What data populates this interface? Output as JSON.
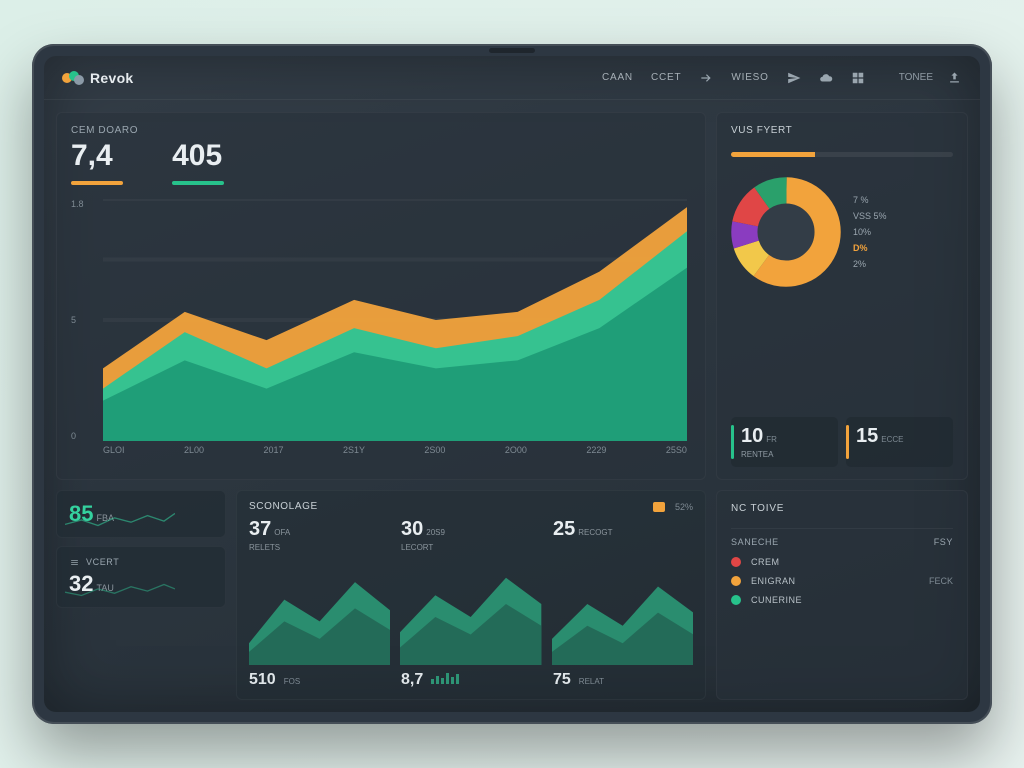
{
  "brand": "Revok",
  "nav": {
    "n0": "CAAN",
    "n1": "CCET",
    "n2": "WIESO"
  },
  "top_right": {
    "chip": "TONEE"
  },
  "main": {
    "metric1_label": "Cem Doaro",
    "metric1_value": "7,4",
    "metric2_value": "405",
    "y": {
      "t0": "1.8",
      "t1": "5",
      "t2": "0"
    },
    "x": {
      "c0": "GLOI",
      "c1": "2L00",
      "c2": "2017",
      "c3": "2S1Y",
      "c4": "2S00",
      "c5": "2O00",
      "c6": "2229",
      "c7": "25S0"
    }
  },
  "right": {
    "title": "Vus Fyert",
    "pie": {
      "l0": "7 %",
      "l1": "VSS 5%",
      "l2": "10%",
      "l3": "D%",
      "l4": "2%"
    },
    "m1_v": "10",
    "m1_s": "FR",
    "m1_cap": "Rentea",
    "m2_v": "15",
    "m2_s": "ECCE",
    "m2_cap": ""
  },
  "scroll": {
    "title": "SCONOLAGE",
    "badge": "52%",
    "a_v": "85",
    "a_s": "FBA",
    "b_title": "VCERT",
    "b_v": "32",
    "b_s": "TAU",
    "m1_v": "37",
    "m1_s": "OFA",
    "m1_cap": "RELETS",
    "m2_v": "30",
    "m2_s": "20S9",
    "m2_cap": "LECORT",
    "m3_v": "25",
    "m3_s": "RECOGT",
    "m3_cap": "",
    "f1": "510",
    "f1c": "FOS",
    "f2": "8,7",
    "f2c": "",
    "f3": "75",
    "f3c": "RELAT"
  },
  "br": {
    "title": "NC TOIVE",
    "sub_t": "SANECHE",
    "sub_r": "FSY",
    "i1": "CREM",
    "i1r": "",
    "i2": "ENIGRAN",
    "i2r": "FECK",
    "i3": "CUNERINE",
    "i3r": ""
  },
  "colors": {
    "orange": "#f2a33c",
    "teal": "#27c28b",
    "teal2": "#2fae86",
    "purple": "#8a3cc0",
    "red": "#e04646",
    "yellow": "#f2c84a",
    "green": "#2aa06b"
  },
  "chart_data": [
    {
      "type": "area",
      "title": "Cem Doaro",
      "ylim": [
        0,
        1.8
      ],
      "categories": [
        "GLOI",
        "2L00",
        "2017",
        "2S1Y",
        "2S00",
        "2O00",
        "2229",
        "25S0"
      ],
      "series": [
        {
          "name": "orange",
          "values": [
            0.55,
            0.95,
            0.75,
            1.05,
            0.9,
            0.95,
            1.25,
            1.75
          ]
        },
        {
          "name": "teal-light",
          "values": [
            0.4,
            0.8,
            0.55,
            0.85,
            0.7,
            0.78,
            1.05,
            1.55
          ]
        },
        {
          "name": "teal-dark",
          "values": [
            0.3,
            0.6,
            0.4,
            0.65,
            0.55,
            0.6,
            0.85,
            1.3
          ]
        }
      ]
    },
    {
      "type": "pie",
      "title": "Vus Fyert",
      "slices": [
        {
          "label": "D%",
          "value": 60,
          "color": "#f2a33c"
        },
        {
          "label": "7 %",
          "value": 10,
          "color": "#f2c84a"
        },
        {
          "label": "VSS 5%",
          "value": 8,
          "color": "#8a3cc0"
        },
        {
          "label": "10%",
          "value": 12,
          "color": "#e04646"
        },
        {
          "label": "2%",
          "value": 10,
          "color": "#2aa06b"
        }
      ]
    }
  ]
}
